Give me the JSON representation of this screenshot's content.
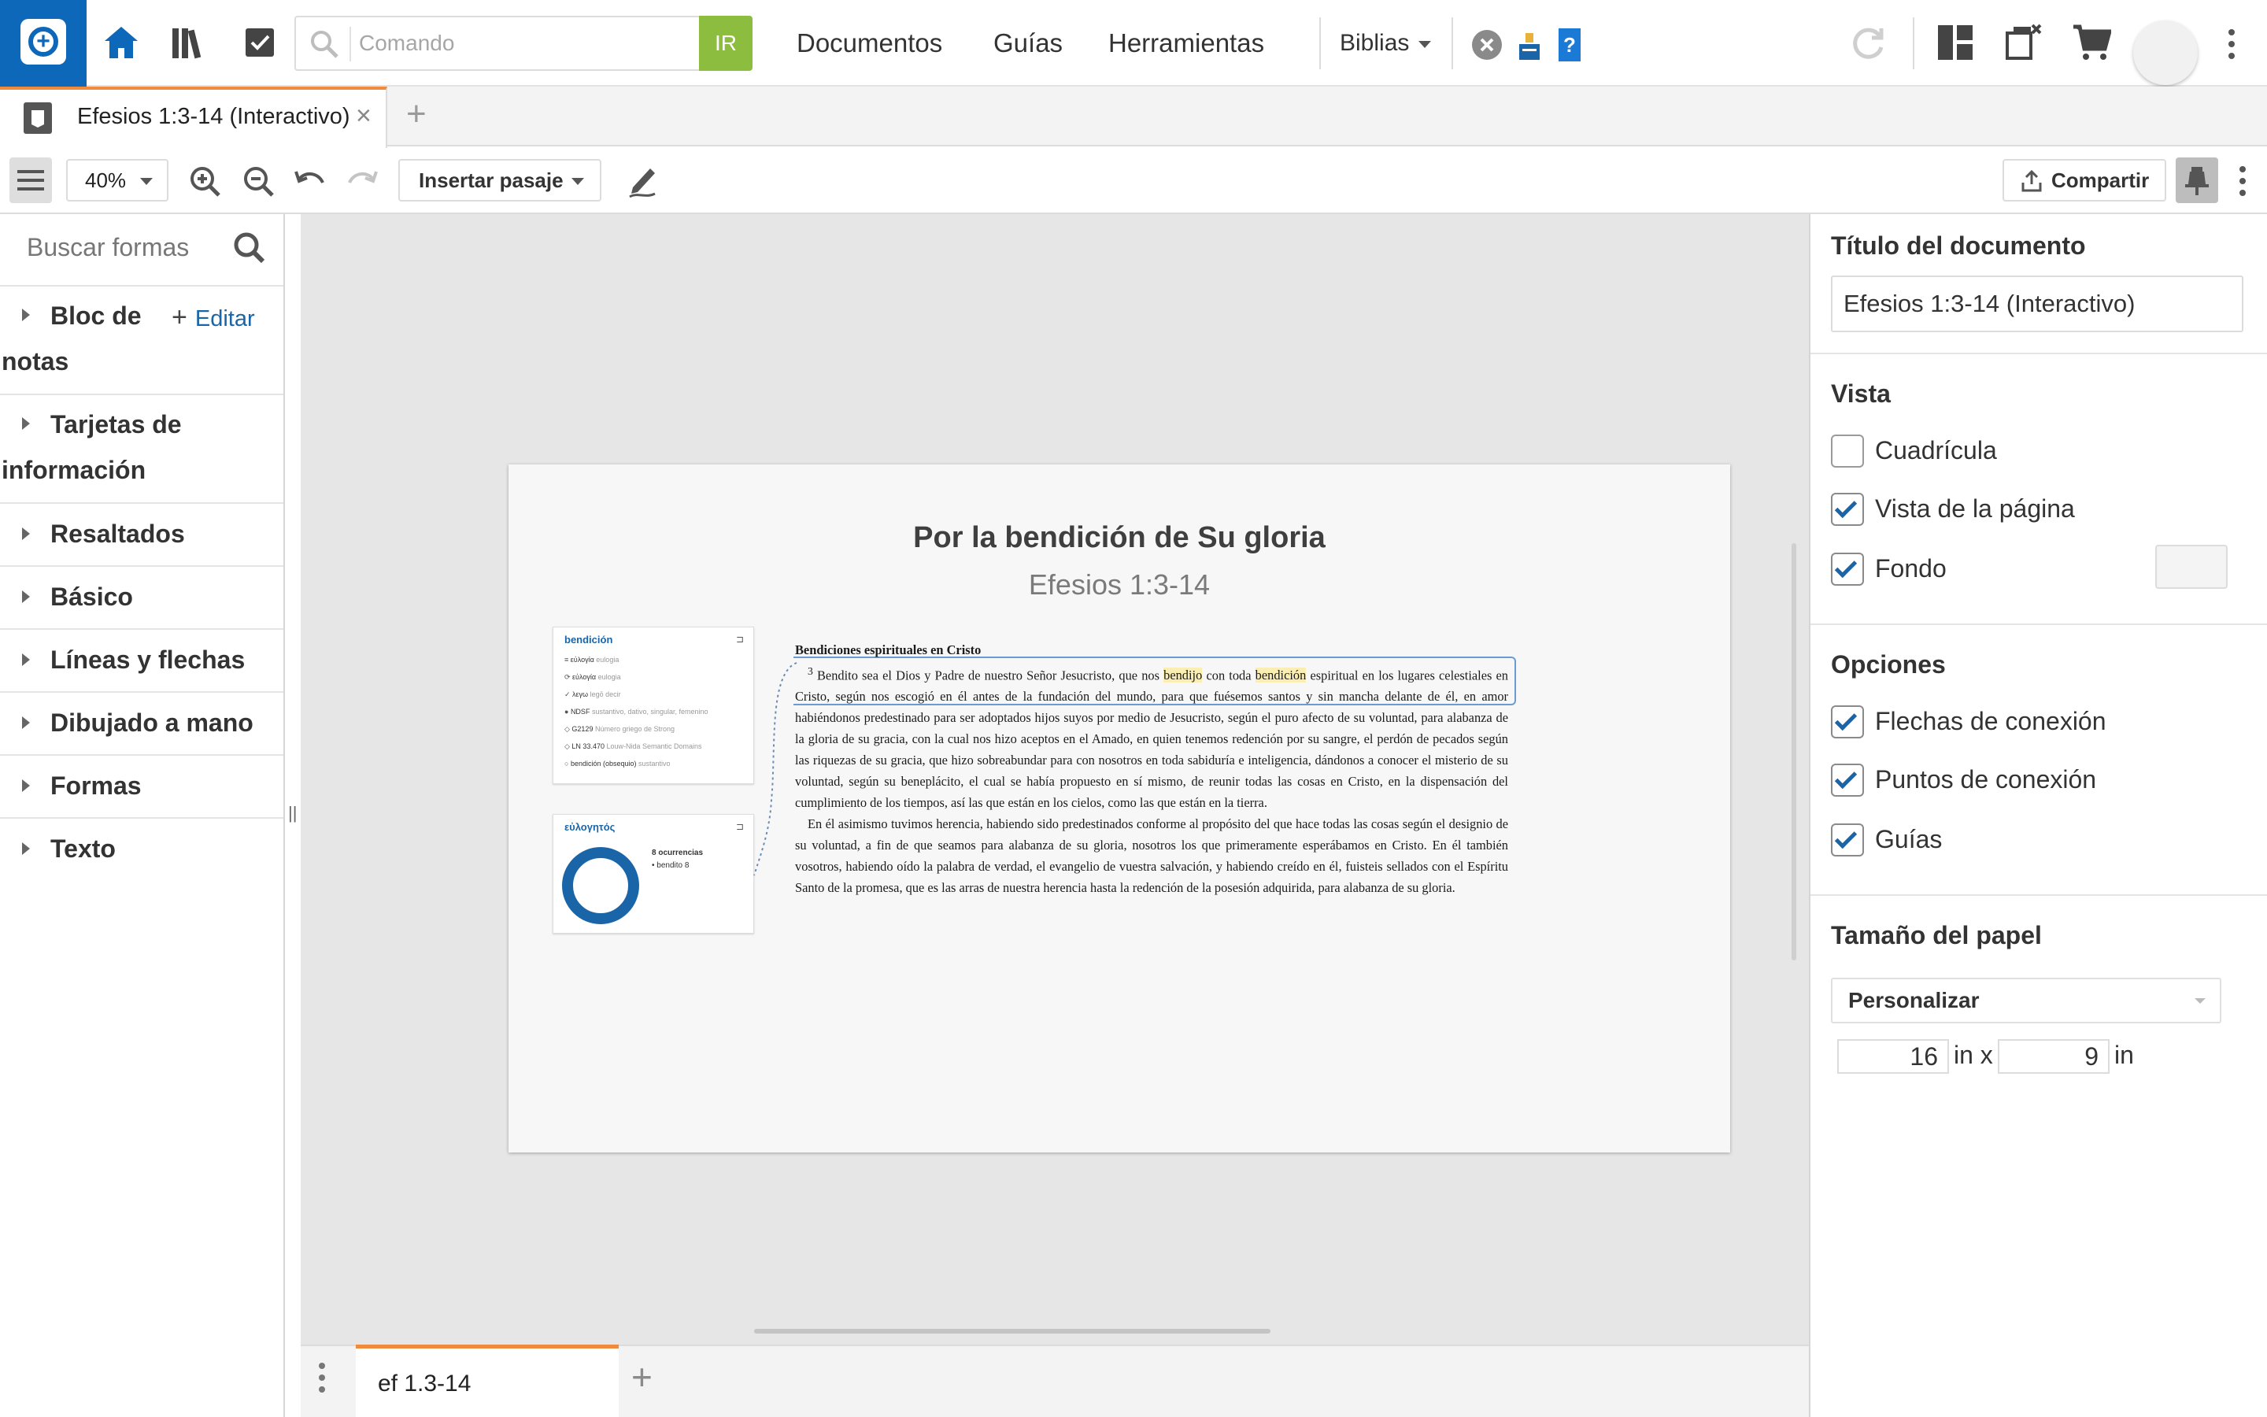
{
  "topbar": {
    "command_placeholder": "Comando",
    "go_label": "IR",
    "nav": [
      "Documentos",
      "Guías",
      "Herramientas"
    ],
    "biblias_label": "Biblias"
  },
  "tabs": {
    "active_tab": "Efesios 1:3-14 (Interactivo)"
  },
  "toolbar": {
    "zoom": "40%",
    "insert_passage": "Insertar pasaje",
    "share": "Compartir"
  },
  "left_panel": {
    "search_placeholder": "Buscar formas",
    "edit_label": "Editar",
    "sections": [
      {
        "line1": "Bloc de",
        "line2": "notas"
      },
      {
        "line1": "Tarjetas de",
        "line2": "información"
      },
      {
        "line1": "Resaltados",
        "line2": ""
      },
      {
        "line1": "Básico",
        "line2": ""
      },
      {
        "line1": "Líneas y flechas",
        "line2": ""
      },
      {
        "line1": "Dibujado a mano",
        "line2": ""
      },
      {
        "line1": "Formas",
        "line2": ""
      },
      {
        "line1": "Texto",
        "line2": ""
      }
    ]
  },
  "document": {
    "title": "Por la bendición de Su gloria",
    "subtitle": "Efesios 1:3-14",
    "card_word": {
      "title": "bendición",
      "rows": [
        {
          "main": "εὐλογία",
          "note": "eulogia"
        },
        {
          "main": "εὐλογία",
          "note": "eulogia"
        },
        {
          "main": "λεγω",
          "note": "legō decir"
        },
        {
          "main": "NDSF",
          "note": "sustantivo, dativo, singular, femenino"
        },
        {
          "main": "G2129",
          "note": "Número griego de Strong"
        },
        {
          "main": "LN 33.470",
          "note": "Louw-Nida Semantic Domains"
        },
        {
          "main": "bendición (obsequio)",
          "note": "sustantivo"
        }
      ]
    },
    "card_greek": {
      "title": "εὐλογητός",
      "occurrences": "8 ocurrencias",
      "legend": "• bendito 8"
    },
    "heading": "Bendiciones espirituales en Cristo",
    "v3a": "Bendito sea el Dios y Padre de nuestro Señor Jesucristo, que nos ",
    "v3_hl1": "bendijo",
    "v3b": " con toda ",
    "v3_hl2": "bendición",
    "v3c": " espiritual en los lugares celestiales en Cristo,",
    "rest": " según nos escogió en él antes de la fundación del mundo, para que fuésemos santos y sin mancha delante de él, en amor habiéndonos predestinado para ser adoptados hijos suyos por medio de Jesucristo, según el puro afecto de su voluntad, para alabanza de la gloria de su gracia, con la cual nos hizo aceptos en el Amado, en quien tenemos redención por su sangre, el perdón de pecados según las riquezas de su gracia, que hizo sobreabundar para con nosotros en toda sabiduría e inteligencia, dándonos a conocer el misterio de su voluntad, según su beneplácito, el cual se había propuesto en sí mismo, de reunir todas las cosas en Cristo, en la dispensación del cumplimiento de los tiempos, así las que están en los cielos, como las que están en la tierra.",
    "rest2": "En él asimismo tuvimos herencia, habiendo sido predestinados conforme al propósito del que hace todas las cosas según el designio de su voluntad, a fin de que seamos para alabanza de su gloria, nosotros los que primeramente esperábamos en Cristo. En él también vosotros, habiendo oído la palabra de verdad, el evangelio de vuestra salvación, y habiendo creído en él, fuisteis sellados con el Espíritu Santo de la promesa, que es las arras de nuestra herencia hasta la redención de la posesión adquirida, para alabanza de su gloria."
  },
  "bottom": {
    "page_tab": "ef 1.3-14"
  },
  "right_panel": {
    "doc_title_label": "Título del documento",
    "doc_title_value": "Efesios 1:3-14 (Interactivo)",
    "vista_label": "Vista",
    "vista_options": [
      {
        "label": "Cuadrícula",
        "checked": false
      },
      {
        "label": "Vista de la página",
        "checked": true
      },
      {
        "label": "Fondo",
        "checked": true
      }
    ],
    "opciones_label": "Opciones",
    "opciones_options": [
      {
        "label": "Flechas de conexión",
        "checked": true
      },
      {
        "label": "Puntos de conexión",
        "checked": true
      },
      {
        "label": "Guías",
        "checked": true
      }
    ],
    "paper_label": "Tamaño del papel",
    "paper_value": "Personalizar",
    "width": "16",
    "height": "9",
    "unit": "in",
    "unit_x": "in x"
  },
  "colors": {
    "brand_blue": "#0e68b9",
    "go_green": "#8cbd3e",
    "tab_accent": "#f08a3c",
    "highlight": "#fbeeb3"
  }
}
